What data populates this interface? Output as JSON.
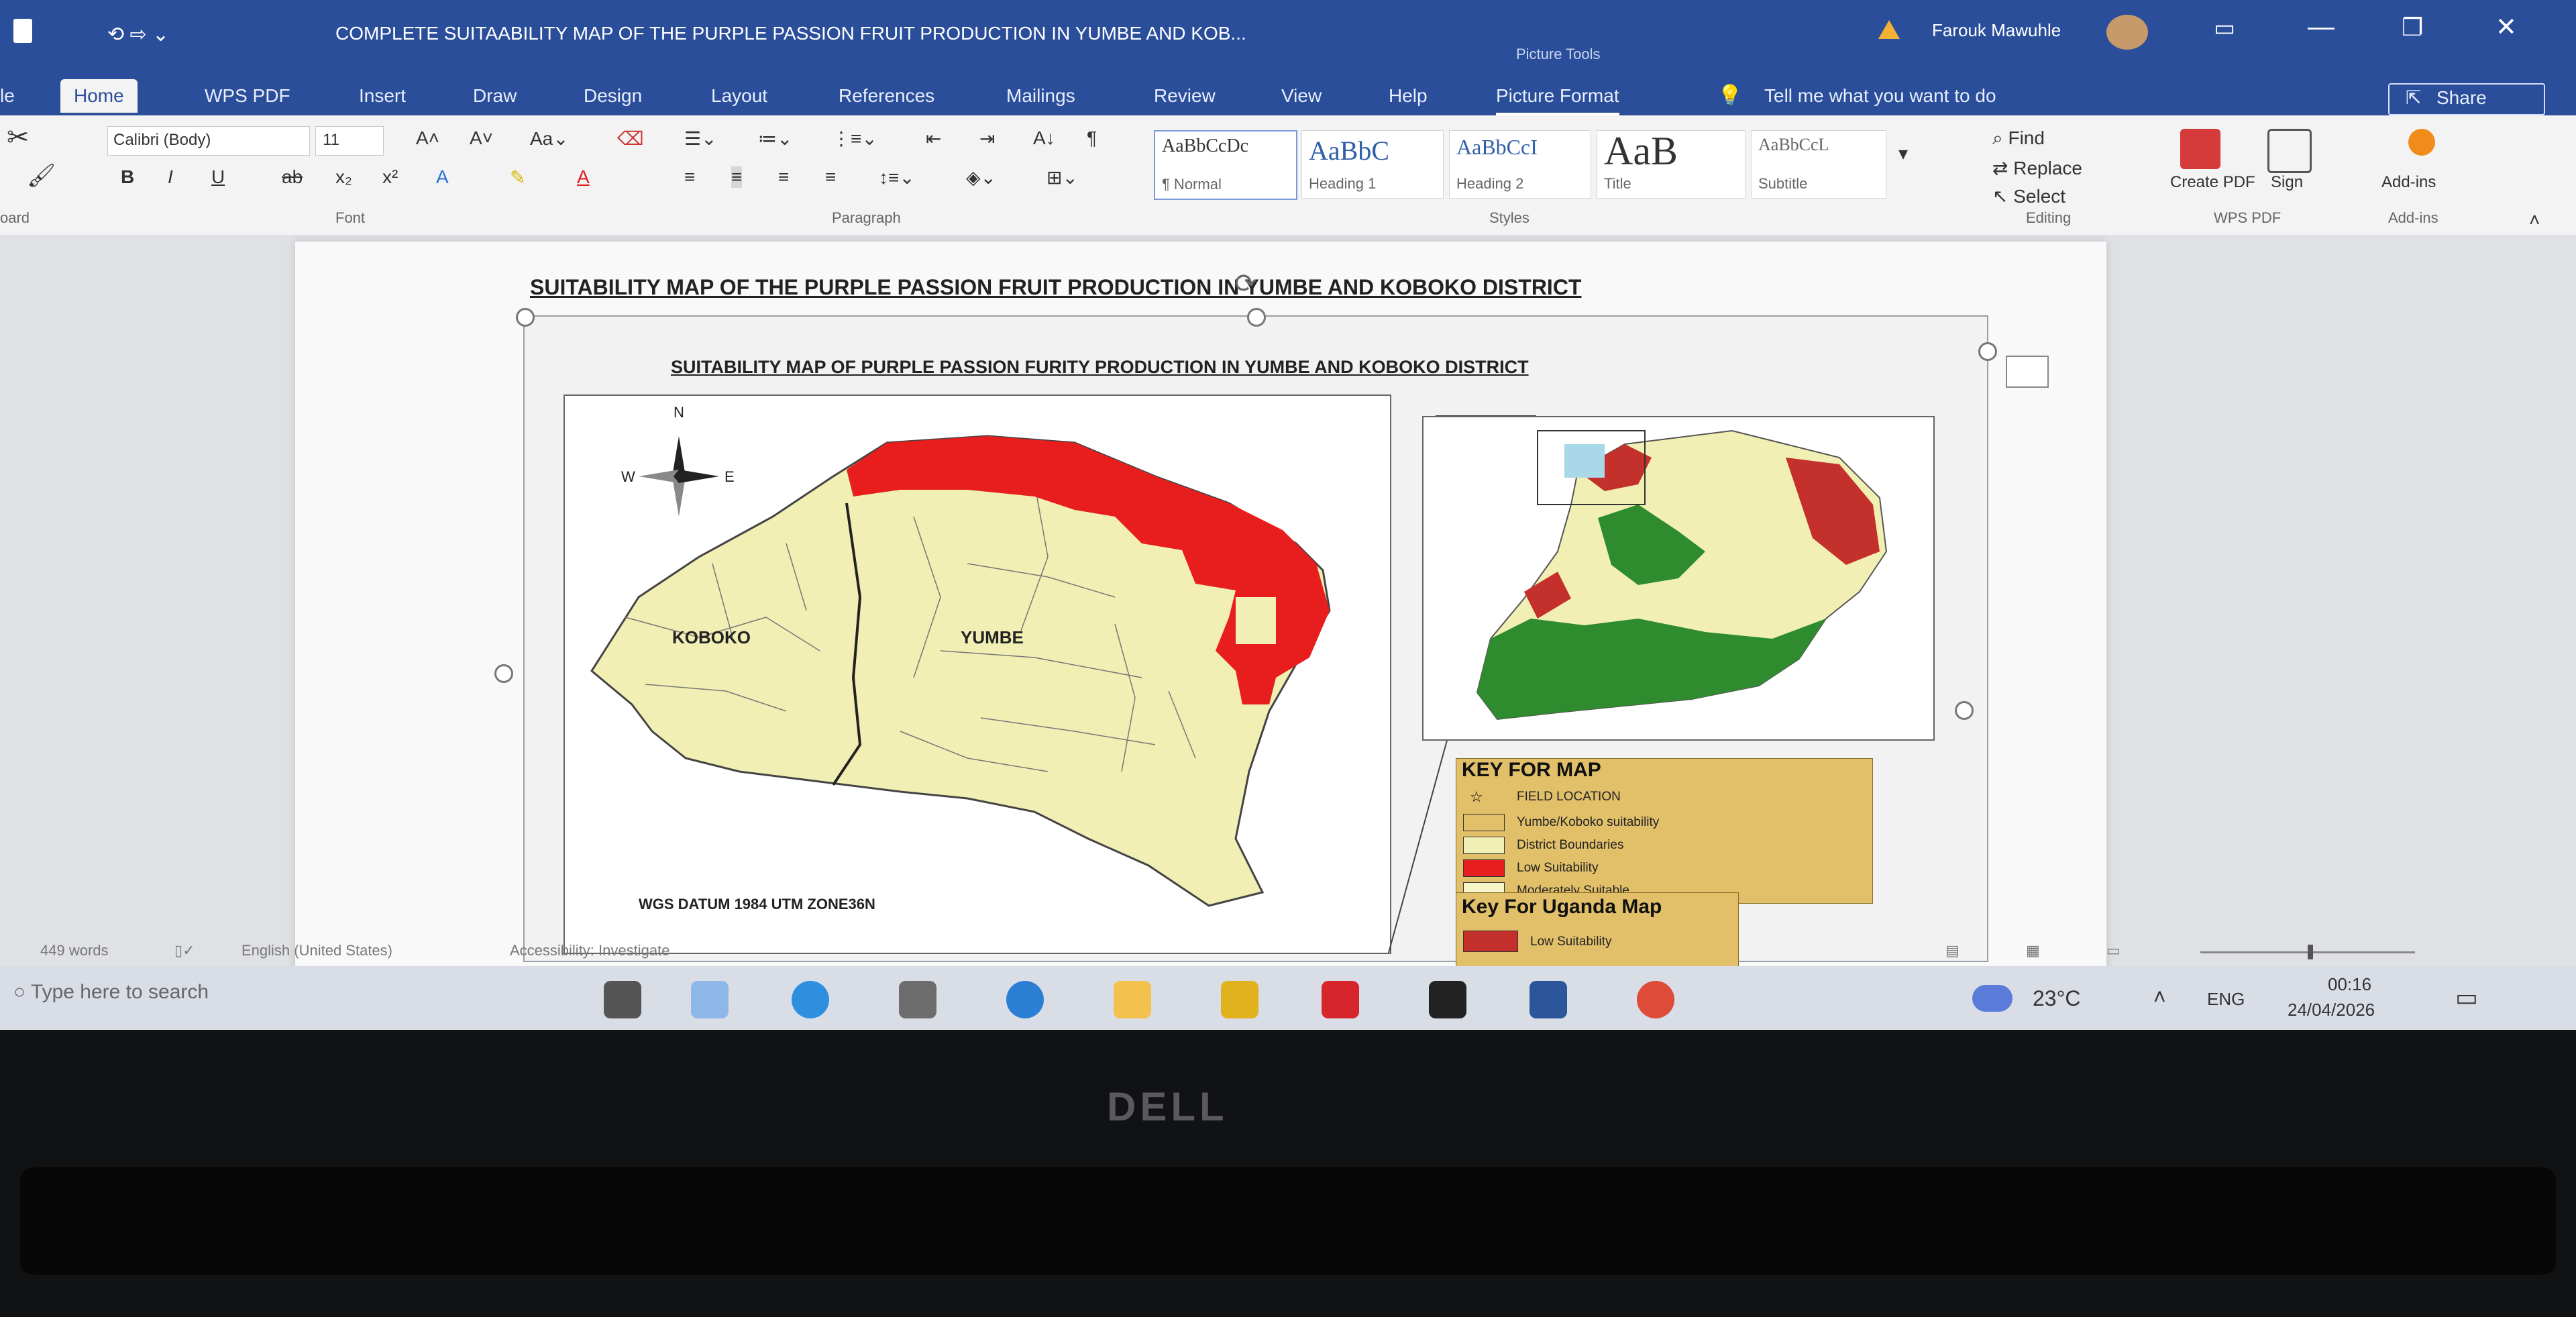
{
  "window": {
    "title": "COMPLETE SUITAABILITY MAP OF THE PURPLE PASSION FRUIT PRODUCTION IN YUMBE AND KOB...",
    "context_tab": "Picture Tools",
    "user": "Farouk Mawuhle",
    "quick_access": "⟲ ⇨ ⌄"
  },
  "ribbon": {
    "tabs": [
      "Home",
      "WPS PDF",
      "Insert",
      "Draw",
      "Design",
      "Layout",
      "References",
      "Mailings",
      "Review",
      "View",
      "Help",
      "Picture Format"
    ],
    "search_placeholder": "Tell me what you want to do",
    "share_label": "Share",
    "font_name": "Calibri (Body)",
    "font_size": "11",
    "groups": [
      "Font",
      "Paragraph",
      "Styles",
      "Editing",
      "WPS PDF",
      "Add-ins"
    ],
    "clipboard_label": "oard",
    "styles": [
      {
        "sample": "AaBbCcDc",
        "name": "¶ Normal"
      },
      {
        "sample": "AaBbC",
        "name": "Heading 1"
      },
      {
        "sample": "AaBbCcI",
        "name": "Heading 2"
      },
      {
        "sample": "AaB",
        "name": "Title"
      },
      {
        "sample": "AaBbCcL",
        "name": "Subtitle"
      }
    ],
    "editing": [
      "Find",
      "Replace",
      "Select"
    ],
    "create_pdf": "Create PDF",
    "sign": "Sign",
    "addins": "Add-ins"
  },
  "document": {
    "title": "SUITABILITY MAP OF THE PURPLE PASSION FRUIT PRODUCTION IN YUMBE AND KOBOKO DISTRICT",
    "map_title": "SUITABILITY MAP OF PURPLE PASSION FURITY PRODUCTION IN YUMBE AND KOBOKO DISTRICT",
    "district_a": "KOBOKO",
    "district_b": "YUMBE",
    "north": "N",
    "east": "E",
    "west": "W",
    "datum": "WGS DATUM 1984 UTM ZONE36N",
    "key_title": "KEY FOR MAP",
    "key_items": [
      "FIELD LOCATION",
      "Yumbe/Koboko suitability",
      "District Boundaries",
      "Low Suitability",
      "Moderately Suitable"
    ],
    "key2_title": "Key For Uganda Map",
    "key2_items": [
      "Low Suitability"
    ]
  },
  "statusbar": {
    "words": "449 words",
    "lang": "English (United States)",
    "accessibility": "Accessibility: Investigate"
  },
  "taskbar": {
    "search_placeholder": "Type here to search",
    "temperature": "23°C",
    "lang": "ENG",
    "time": "00:16",
    "date": "24/04/2026"
  },
  "laptop": {
    "brand": "DELL"
  },
  "colors": {
    "accent": "#2b4e9b",
    "high": "#e81e1e",
    "moderate": "#f1efb4",
    "uganda_green": "#2e8b2e"
  }
}
